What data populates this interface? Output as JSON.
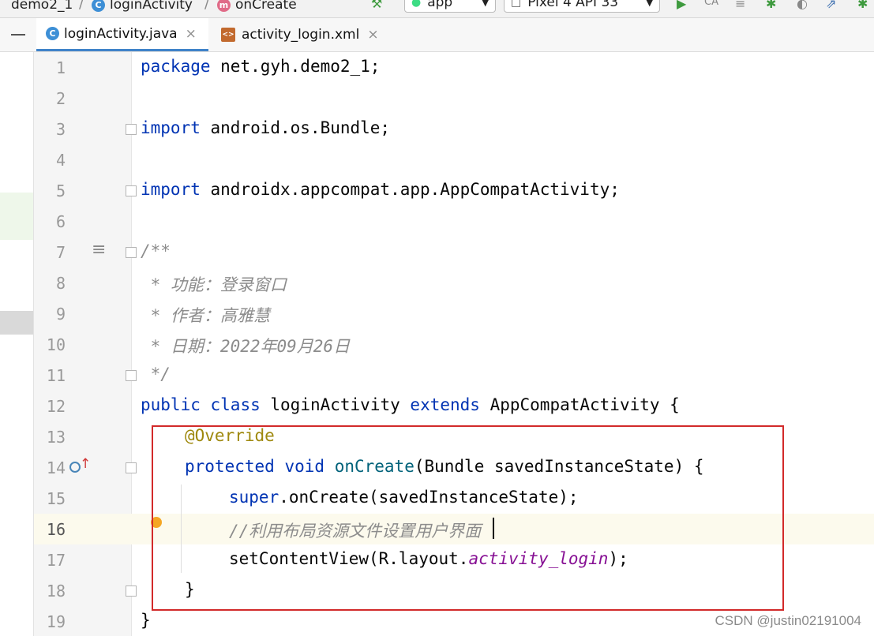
{
  "breadcrumb": {
    "project": "demo2_1",
    "cls": "loginActivity",
    "method": "onCreate"
  },
  "toolbar": {
    "app_config": "app",
    "device": "Pixel 4 API 33"
  },
  "tabs": [
    {
      "label": "loginActivity.java",
      "active": true
    },
    {
      "label": "activity_login.xml",
      "active": false
    }
  ],
  "line_numbers": [
    "1",
    "2",
    "3",
    "4",
    "5",
    "6",
    "7",
    "8",
    "9",
    "10",
    "11",
    "12",
    "13",
    "14",
    "15",
    "16",
    "17",
    "18",
    "19"
  ],
  "current_line": 16,
  "code": {
    "l1_kw": "package",
    "l1_rest": " net.gyh.demo2_1;",
    "l3_kw": "import",
    "l3_rest": " android.os.Bundle;",
    "l5_kw": "import",
    "l5_rest": " androidx.appcompat.app.AppCompatActivity;",
    "l7": "/**",
    "l8": " * 功能：登录窗口",
    "l9": " * 作者：高雅慧",
    "l10": " * 日期：2022年09月26日",
    "l11": " */",
    "l12_kw1": "public",
    "l12_kw2": "class",
    "l12_name": "loginActivity",
    "l12_kw3": "extends",
    "l12_rest": "AppCompatActivity {",
    "l13": "@Override",
    "l14_kw1": "protected",
    "l14_kw2": "void",
    "l14_method": "onCreate",
    "l14_rest": "(Bundle savedInstanceState) {",
    "l15_kw": "super",
    "l15_rest": ".onCreate(savedInstanceState);",
    "l16": "//利用布局资源文件设置用户界面",
    "l17_pre": "setContentView(R.layout.",
    "l17_field": "activity_login",
    "l17_post": ");",
    "l18": "}",
    "l19": "}"
  },
  "watermark": "CSDN @justin02191004",
  "colors": {
    "keyword": "#0033b3",
    "comment": "#8c8c8c",
    "annotation": "#9e880d",
    "highlight_box": "#d22a2a"
  }
}
